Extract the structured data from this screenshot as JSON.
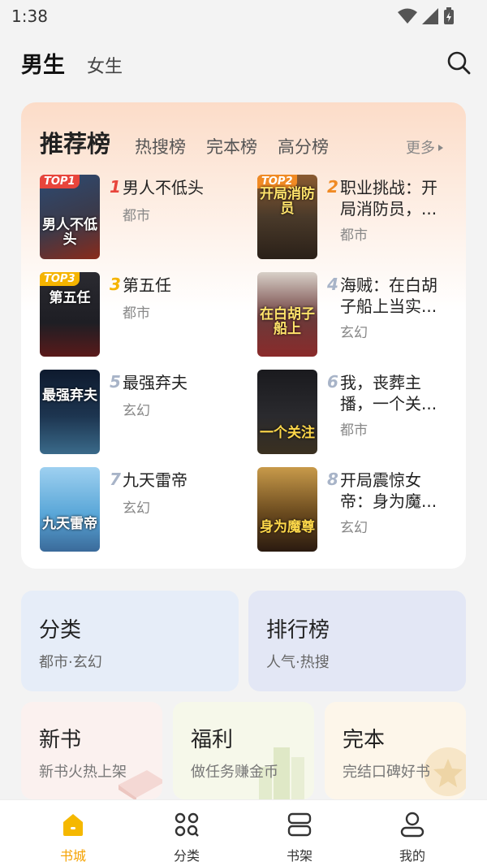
{
  "status_bar": {
    "time": "1:38"
  },
  "top_tabs": {
    "male": "男生",
    "female": "女生"
  },
  "ranking": {
    "title": "推荐榜",
    "tabs": [
      "热搜榜",
      "完本榜",
      "高分榜"
    ],
    "more": "更多",
    "books": [
      {
        "rank": "1",
        "badge": "TOP1",
        "title": "男人不低头",
        "category": "都市",
        "cover_text": "男人不低头",
        "cover_color": "#3b3a4a"
      },
      {
        "rank": "2",
        "badge": "TOP2",
        "title": "职业挑战：开局消防员，...",
        "category": "都市",
        "cover_text": "开局消防员",
        "cover_color": "#4a3a2a"
      },
      {
        "rank": "3",
        "badge": "TOP3",
        "title": "第五任",
        "category": "都市",
        "cover_text": "第五任",
        "cover_color": "#1e1e24"
      },
      {
        "rank": "4",
        "badge": "",
        "title": "海贼：在白胡子船上当实...",
        "category": "玄幻",
        "cover_text": "在白胡子船上",
        "cover_color": "#6b3a3a"
      },
      {
        "rank": "5",
        "badge": "",
        "title": "最强弃夫",
        "category": "玄幻",
        "cover_text": "最强弃夫",
        "cover_color": "#1d3550"
      },
      {
        "rank": "6",
        "badge": "",
        "title": "我，丧葬主播，一个关...",
        "category": "都市",
        "cover_text": "一个关注",
        "cover_color": "#2a2a2e"
      },
      {
        "rank": "7",
        "badge": "",
        "title": "九天雷帝",
        "category": "玄幻",
        "cover_text": "九天雷帝",
        "cover_color": "#5aa7d8"
      },
      {
        "rank": "8",
        "badge": "",
        "title": "开局震惊女帝：身为魔...",
        "category": "玄幻",
        "cover_text": "身为魔尊",
        "cover_color": "#6a4a1e"
      }
    ]
  },
  "shortcuts": {
    "category": {
      "title": "分类",
      "subtitle": "都市·玄幻"
    },
    "charts": {
      "title": "排行榜",
      "subtitle": "人气·热搜"
    },
    "new_books": {
      "title": "新书",
      "subtitle": "新书火热上架"
    },
    "welfare": {
      "title": "福利",
      "subtitle": "做任务赚金币"
    },
    "finished": {
      "title": "完本",
      "subtitle": "完结口碑好书"
    }
  },
  "bottom_nav": {
    "bookstore": "书城",
    "category": "分类",
    "shelf": "书架",
    "mine": "我的"
  },
  "colors": {
    "accent": "#f5a200",
    "rank_1": "#e8453c",
    "rank_2": "#f08a24",
    "rank_3": "#f5b400",
    "rank_other": "#a8b4c8"
  }
}
